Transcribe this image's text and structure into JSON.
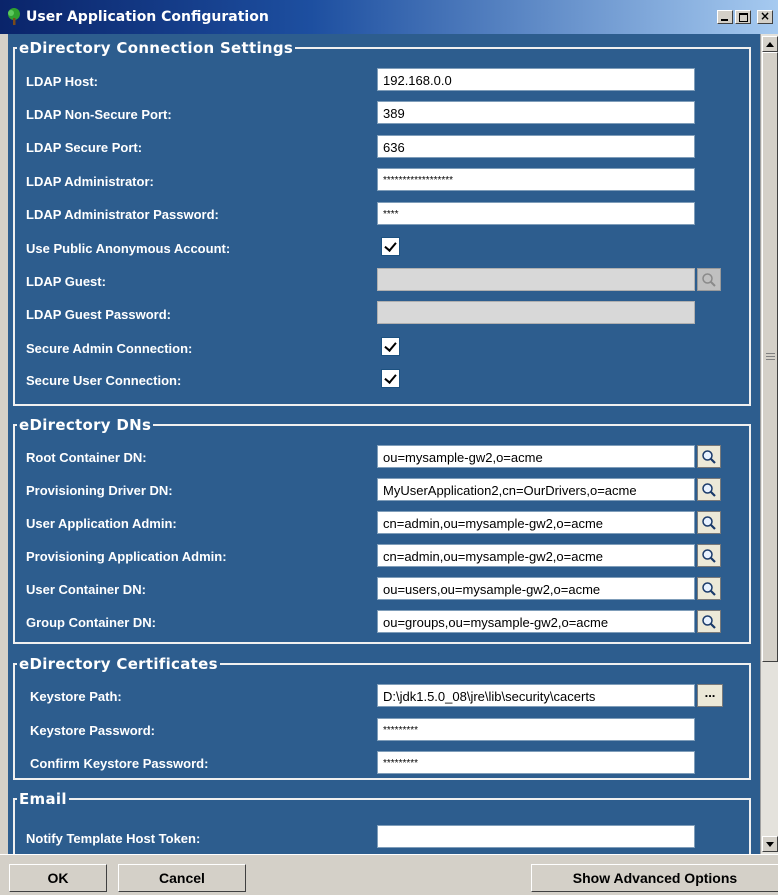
{
  "window": {
    "title": "User Application Configuration",
    "icon": "tree-icon"
  },
  "sections": {
    "connection": {
      "legend": "eDirectory Connection Settings",
      "ldap_host": {
        "label": "LDAP Host:",
        "value": "192.168.0.0"
      },
      "ldap_nonsecure_port": {
        "label": "LDAP Non-Secure Port:",
        "value": "389"
      },
      "ldap_secure_port": {
        "label": "LDAP Secure Port:",
        "value": "636"
      },
      "ldap_admin": {
        "label": "LDAP Administrator:",
        "value": "******************"
      },
      "ldap_admin_password": {
        "label": "LDAP Administrator Password:",
        "value": "****"
      },
      "use_public_anonymous": {
        "label": "Use Public Anonymous Account:",
        "checked": true
      },
      "ldap_guest": {
        "label": "LDAP Guest:",
        "value": ""
      },
      "ldap_guest_password": {
        "label": "LDAP Guest Password:",
        "value": ""
      },
      "secure_admin_connection": {
        "label": "Secure Admin Connection:",
        "checked": true
      },
      "secure_user_connection": {
        "label": "Secure User Connection:",
        "checked": true
      }
    },
    "dns": {
      "legend": "eDirectory DNs",
      "root_container": {
        "label": "Root Container DN:",
        "value": "ou=mysample-gw2,o=acme"
      },
      "provisioning_driver": {
        "label": "Provisioning Driver DN:",
        "value": "MyUserApplication2,cn=OurDrivers,o=acme"
      },
      "user_app_admin": {
        "label": "User Application Admin:",
        "value": "cn=admin,ou=mysample-gw2,o=acme"
      },
      "provisioning_app_admin": {
        "label": "Provisioning Application Admin:",
        "value": "cn=admin,ou=mysample-gw2,o=acme"
      },
      "user_container": {
        "label": "User Container DN:",
        "value": "ou=users,ou=mysample-gw2,o=acme"
      },
      "group_container": {
        "label": "Group Container DN:",
        "value": "ou=groups,ou=mysample-gw2,o=acme"
      }
    },
    "certificates": {
      "legend": "eDirectory Certificates",
      "keystore_path": {
        "label": "Keystore Path:",
        "value": "D:\\jdk1.5.0_08\\jre\\lib\\security\\cacerts",
        "browse_label": "..."
      },
      "keystore_password": {
        "label": "Keystore Password:",
        "value": "*********"
      },
      "confirm_keystore_password": {
        "label": "Confirm Keystore Password:",
        "value": "*********"
      }
    },
    "email": {
      "legend": "Email",
      "notify_host_token": {
        "label": "Notify Template Host Token:",
        "value": ""
      }
    }
  },
  "buttons": {
    "ok": "OK",
    "cancel": "Cancel",
    "advanced": "Show Advanced Options"
  },
  "colors": {
    "panel_bg": "#2d5d8e",
    "title_bar": "#0a246a"
  }
}
